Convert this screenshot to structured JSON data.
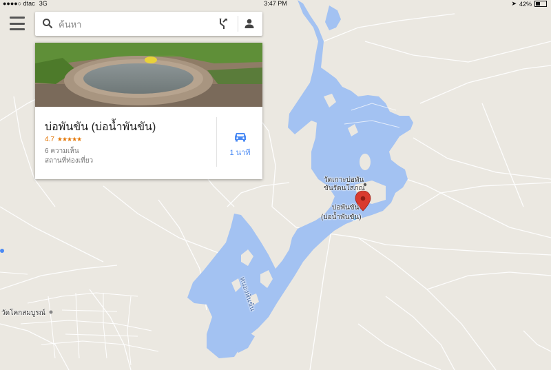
{
  "status_bar": {
    "carrier": "●●●●○ dtac",
    "network": "3G",
    "time": "3:47 PM",
    "battery": "42%",
    "battery_level": 0.42
  },
  "search": {
    "placeholder": "ค้นหา"
  },
  "place_card": {
    "name": "บ่อพันขัน (บ่อน้ำพันขัน)",
    "rating": "4.7",
    "stars": "★★★★★",
    "reviews": "6 ความเห็น",
    "category": "สถานที่ท่องเที่ยว",
    "drive_time": "1 นาที"
  },
  "map": {
    "labels": {
      "temple": "วัดเกาะบ่อพัน\nขันรัตนโสภณ",
      "place_line1": "บ่อพันขัน",
      "place_line2": "(บ่อน้ำพันขัน)",
      "lake": "หนองพันขัน",
      "temple2": "วัดโคกสมบูรณ์"
    },
    "colors": {
      "land": "#ebe8e1",
      "water": "#a3c2f2",
      "road": "#ffffff",
      "pin": "#d93a2f",
      "accent": "#4a8af4"
    }
  },
  "icons": [
    "menu-icon",
    "search-icon",
    "directions-icon",
    "account-icon",
    "car-icon",
    "map-pin-icon"
  ]
}
